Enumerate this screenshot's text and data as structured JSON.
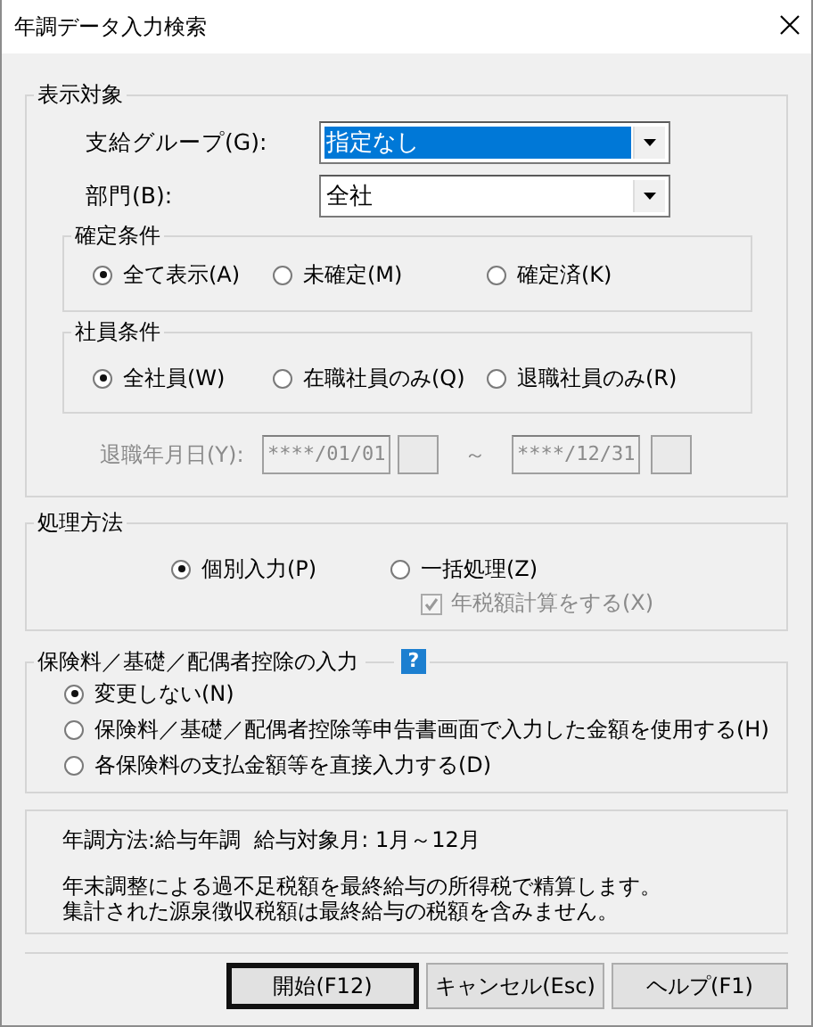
{
  "window": {
    "title": "年調データ入力検索"
  },
  "display_target": {
    "title": "表示対象",
    "fields": [
      {
        "label": "支給グループ(G):",
        "value": "指定なし",
        "focused": true
      },
      {
        "label": "部門(B):",
        "value": "全社",
        "focused": false
      }
    ],
    "confirm_condition": {
      "title": "確定条件",
      "options": [
        {
          "label": "全て表示(A)",
          "selected": true
        },
        {
          "label": "未確定(M)",
          "selected": false
        },
        {
          "label": "確定済(K)",
          "selected": false
        }
      ]
    },
    "employee_condition": {
      "title": "社員条件",
      "options": [
        {
          "label": "全社員(W)",
          "selected": true
        },
        {
          "label": "在職社員のみ(Q)",
          "selected": false
        },
        {
          "label": "退職社員のみ(R)",
          "selected": false
        }
      ]
    },
    "retire_date": {
      "label": "退職年月日(Y):",
      "from": "****/01/01",
      "separator": "～",
      "to": "****/12/31",
      "disabled": true
    }
  },
  "processing": {
    "title": "処理方法",
    "options": [
      {
        "label": "個別入力(P)",
        "selected": true
      },
      {
        "label": "一括処理(Z)",
        "selected": false
      }
    ],
    "checkbox": {
      "label": "年税額計算をする(X)",
      "checked": true,
      "disabled": true
    }
  },
  "deduction_input": {
    "title": "保険料／基礎／配偶者控除の入力",
    "help": "?",
    "options": [
      {
        "label": "変更しない(N)",
        "selected": true
      },
      {
        "label": "保険料／基礎／配偶者控除等申告書画面で入力した金額を使用する(H)",
        "selected": false
      },
      {
        "label": "各保険料の支払金額等を直接入力する(D)",
        "selected": false
      }
    ]
  },
  "info": {
    "summary": "年調方法:給与年調  給与対象月: 1月～12月",
    "lines": [
      "年末調整による過不足税額を最終給与の所得税で精算します。",
      "集計された源泉徴収税額は最終給与の税額を含みません。"
    ]
  },
  "buttons": [
    {
      "label": "開始(F12)",
      "default": true
    },
    {
      "label": "キャンセル(Esc)",
      "default": false
    },
    {
      "label": "ヘルプ(F1)",
      "default": false
    }
  ]
}
